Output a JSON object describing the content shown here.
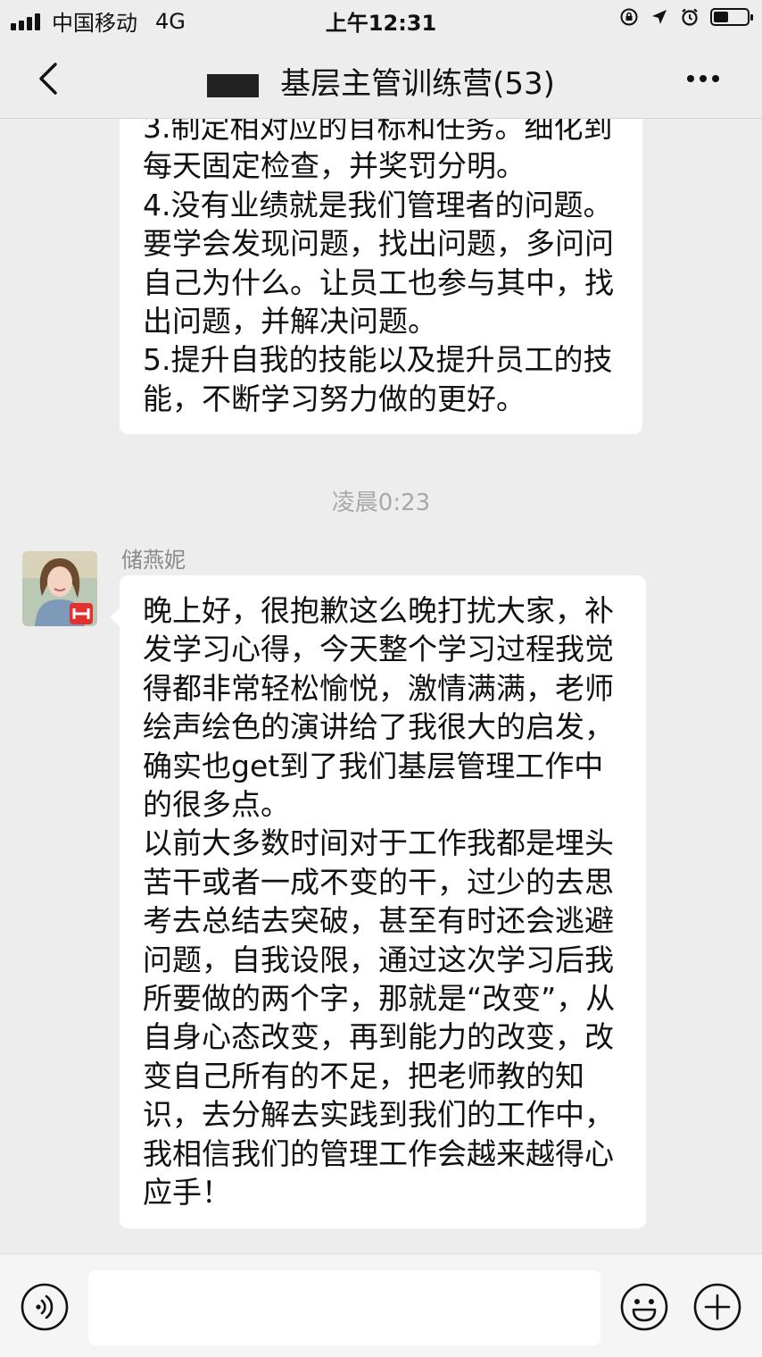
{
  "status_bar": {
    "carrier": "中国移动",
    "network": "4G",
    "time": "上午12:31",
    "battery_level": 0.45
  },
  "nav": {
    "title": "基层主管训练营(53)",
    "title_visible": "基层主管训练营(53)"
  },
  "messages": [
    {
      "text": "3.制定相对应的目标和任务。细化到每天固定检查，并奖罚分明。\n4.没有业绩就是我们管理者的问题。要学会发现问题，找出问题，多问问自己为什么。让员工也参与其中，找出问题，并解决问题。\n5.提升自我的技能以及提升员工的技能，不断学习努力做的更好。"
    },
    {
      "sender": "储燕妮",
      "text": "晚上好，很抱歉这么晚打扰大家，补发学习心得，今天整个学习过程我觉得都非常轻松愉悦，激情满满，老师绘声绘色的演讲给了我很大的启发，确实也get到了我们基层管理工作中的很多点。\n以前大多数时间对于工作我都是埋头苦干或者一成不变的干，过少的去思考去总结去突破，甚至有时还会逃避问题，自我设限，通过这次学习后我所要做的两个字，那就是“改变”，从自身心态改变，再到能力的改变，改变自己所有的不足，把老师教的知识，去分解去实践到我们的工作中，我相信我们的管理工作会越来越得心应手！"
    }
  ],
  "time_separator": "凌晨0:23",
  "icons": {
    "back": "chevron-left-icon",
    "more": "more-dots-icon",
    "voice": "voice-icon",
    "emoji": "emoji-icon",
    "plus": "plus-icon",
    "alarm": "alarm-icon",
    "location": "location-arrow-icon",
    "rotation_lock": "rotation-lock-icon"
  }
}
